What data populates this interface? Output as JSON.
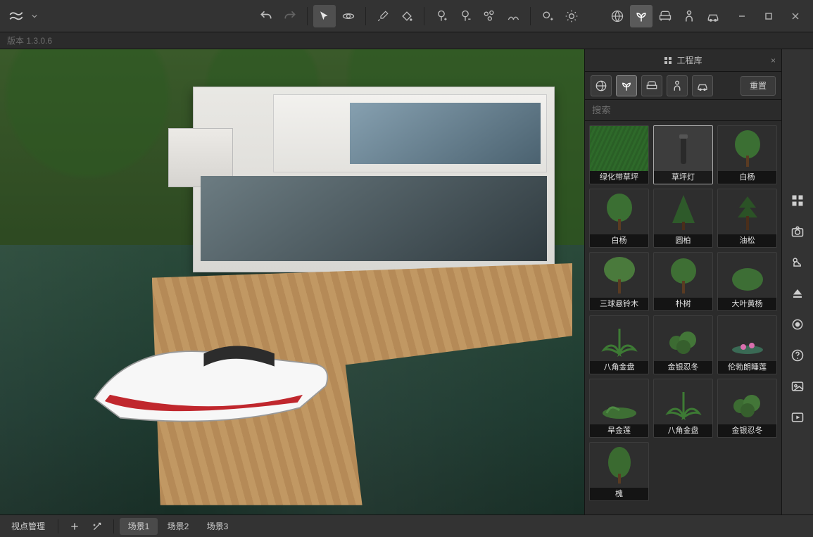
{
  "version_label": "版本 1.3.0.6",
  "library": {
    "title": "工程库",
    "reset_label": "重置",
    "search_placeholder": "搜索",
    "items": [
      {
        "label": "绿化带草坪",
        "thumb": "grass",
        "selected": false
      },
      {
        "label": "草坪灯",
        "thumb": "bollard",
        "selected": true
      },
      {
        "label": "白杨",
        "thumb": "tree1",
        "selected": false
      },
      {
        "label": "白杨",
        "thumb": "tree1",
        "selected": false
      },
      {
        "label": "圆柏",
        "thumb": "conifer",
        "selected": false
      },
      {
        "label": "油松",
        "thumb": "pine",
        "selected": false
      },
      {
        "label": "三球悬铃木",
        "thumb": "tree2",
        "selected": false
      },
      {
        "label": "朴树",
        "thumb": "tree3",
        "selected": false
      },
      {
        "label": "大叶黄杨",
        "thumb": "bush",
        "selected": false
      },
      {
        "label": "八角金盘",
        "thumb": "fern",
        "selected": false
      },
      {
        "label": "金银忍冬",
        "thumb": "shrub",
        "selected": false
      },
      {
        "label": "伦勃朗睡莲",
        "thumb": "lily",
        "selected": false
      },
      {
        "label": "旱金莲",
        "thumb": "groundcover",
        "selected": false
      },
      {
        "label": "八角金盘",
        "thumb": "fern",
        "selected": false
      },
      {
        "label": "金银忍冬",
        "thumb": "shrub",
        "selected": false
      },
      {
        "label": "槐",
        "thumb": "tree4",
        "selected": false
      }
    ]
  },
  "scenes": {
    "manage_label": "视点管理",
    "tabs": [
      {
        "label": "场景1",
        "active": true
      },
      {
        "label": "场景2",
        "active": false
      },
      {
        "label": "场景3",
        "active": false
      }
    ]
  }
}
